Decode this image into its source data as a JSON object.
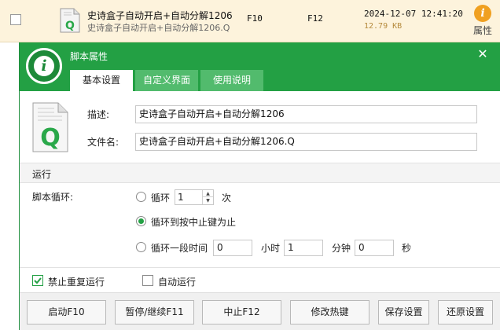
{
  "list_row": {
    "name": "史诗盒子自动开启+自动分解1206",
    "file": "史诗盒子自动开启+自动分解1206.Q",
    "key_start": "F10",
    "key_stop": "F12",
    "date": "2024-12-07 12:41:20",
    "size": "12.79 KB",
    "properties_label": "属性",
    "properties_icon": "info-icon"
  },
  "dialog": {
    "title": "脚本属性",
    "close_icon": "close-icon",
    "tabs": [
      {
        "label": "基本设置",
        "active": true
      },
      {
        "label": "自定义界面",
        "active": false
      },
      {
        "label": "使用说明",
        "active": false
      }
    ],
    "basic": {
      "description_label": "描述:",
      "description_value": "史诗盒子自动开启+自动分解1206",
      "filename_label": "文件名:",
      "filename_value": "史诗盒子自动开启+自动分解1206.Q"
    },
    "run": {
      "section_title": "运行",
      "loop_label": "脚本循环:",
      "option_loop": "循环",
      "loop_count": "1",
      "times_unit": "次",
      "option_until_stop": "循环到按中止键为止",
      "option_duration": "循环一段时间",
      "hours": "0",
      "hours_unit": "小时",
      "minutes": "1",
      "minutes_unit": "分钟",
      "seconds": "0",
      "seconds_unit": "秒",
      "selected": "until_stop"
    },
    "options": {
      "no_repeat_label": "禁止重复运行",
      "no_repeat_checked": true,
      "auto_run_label": "自动运行",
      "auto_run_checked": false
    },
    "buttons": {
      "start": "启动F10",
      "pause": "暂停/继续F11",
      "stop": "中止F12",
      "hotkeys": "修改热键",
      "save": "保存设置",
      "restore": "还原设置"
    },
    "colors": {
      "header": "#23a044",
      "tab_inactive": "#52bb6d",
      "accent": "#23a044"
    }
  }
}
